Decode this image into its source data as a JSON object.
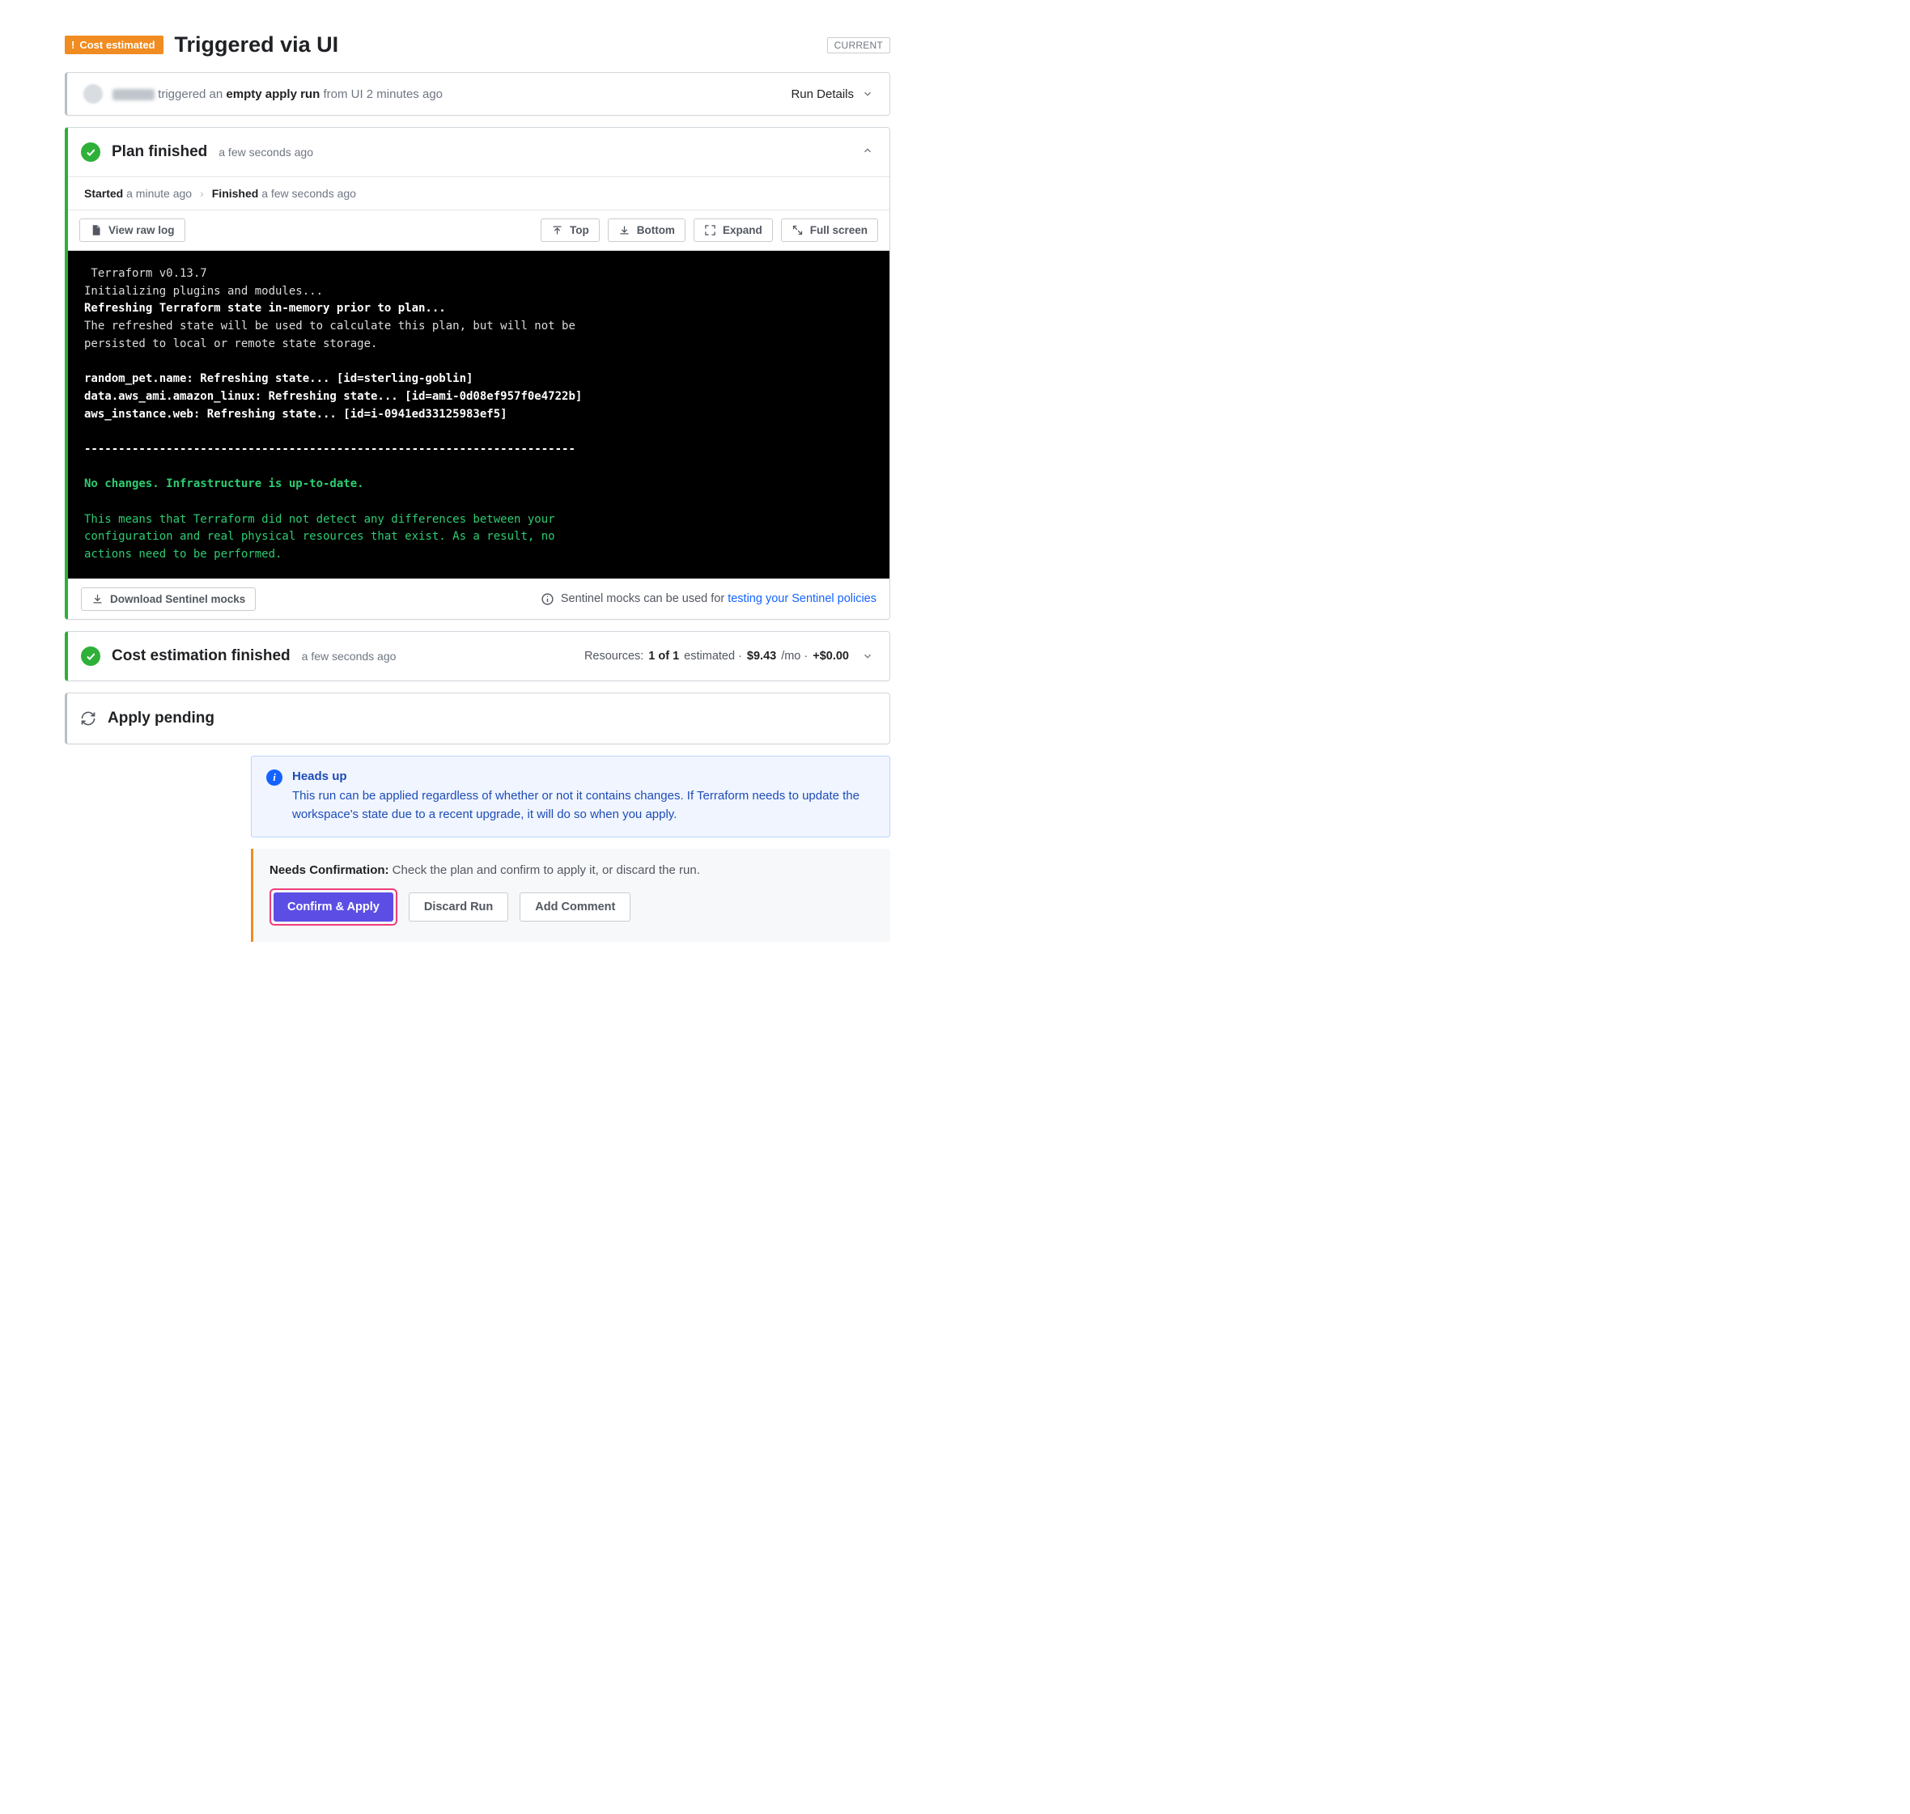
{
  "header": {
    "badge_label": "Cost estimated",
    "title": "Triggered via UI",
    "current_label": "CURRENT"
  },
  "run_row": {
    "verb": "triggered an",
    "kind": "empty apply run",
    "suffix": "from UI 2 minutes ago",
    "details_label": "Run Details"
  },
  "plan": {
    "title": "Plan finished",
    "time": "a few seconds ago",
    "started_label": "Started",
    "started_time": "a minute ago",
    "finished_label": "Finished",
    "finished_time": "a few seconds ago",
    "view_raw_log": "View raw log",
    "btn_top": "Top",
    "btn_bottom": "Bottom",
    "btn_expand": "Expand",
    "btn_fullscreen": "Full screen",
    "download_mocks": "Download Sentinel mocks",
    "mocks_info_prefix": "Sentinel mocks can be used for ",
    "mocks_info_link": "testing your Sentinel policies",
    "log_lines": [
      {
        "text": " Terraform v0.13.7",
        "cls": ""
      },
      {
        "text": "Initializing plugins and modules...",
        "cls": ""
      },
      {
        "text": "Refreshing Terraform state in-memory prior to plan...",
        "cls": "b"
      },
      {
        "text": "The refreshed state will be used to calculate this plan, but will not be",
        "cls": ""
      },
      {
        "text": "persisted to local or remote state storage.",
        "cls": ""
      },
      {
        "text": "",
        "cls": ""
      },
      {
        "text": "random_pet.name: Refreshing state... [id=sterling-goblin]",
        "cls": "b"
      },
      {
        "text": "data.aws_ami.amazon_linux: Refreshing state... [id=ami-0d08ef957f0e4722b]",
        "cls": "b"
      },
      {
        "text": "aws_instance.web: Refreshing state... [id=i-0941ed33125983ef5]",
        "cls": "b"
      },
      {
        "text": "",
        "cls": ""
      },
      {
        "text": "------------------------------------------------------------------------",
        "cls": "b"
      },
      {
        "text": "",
        "cls": ""
      },
      {
        "text": "No changes. Infrastructure is up-to-date.",
        "cls": "gb"
      },
      {
        "text": "",
        "cls": ""
      },
      {
        "text": "This means that Terraform did not detect any differences between your",
        "cls": "g"
      },
      {
        "text": "configuration and real physical resources that exist. As a result, no",
        "cls": "g"
      },
      {
        "text": "actions need to be performed.",
        "cls": "g"
      }
    ]
  },
  "cost": {
    "title": "Cost estimation finished",
    "time": "a few seconds ago",
    "summary_prefix": "Resources: ",
    "summary_count": "1 of 1",
    "summary_mid": " estimated · ",
    "price": "$9.43",
    "per": "/mo · ",
    "delta": "+$0.00"
  },
  "apply": {
    "title": "Apply pending"
  },
  "notice": {
    "title": "Heads up",
    "body": "This run can be applied regardless of whether or not it contains changes. If Terraform needs to update the workspace's state due to a recent upgrade, it will do so when you apply."
  },
  "confirm": {
    "lead": "Needs Confirmation:",
    "body": " Check the plan and confirm to apply it, or discard the run.",
    "confirm_btn": "Confirm & Apply",
    "discard_btn": "Discard Run",
    "comment_btn": "Add Comment"
  }
}
